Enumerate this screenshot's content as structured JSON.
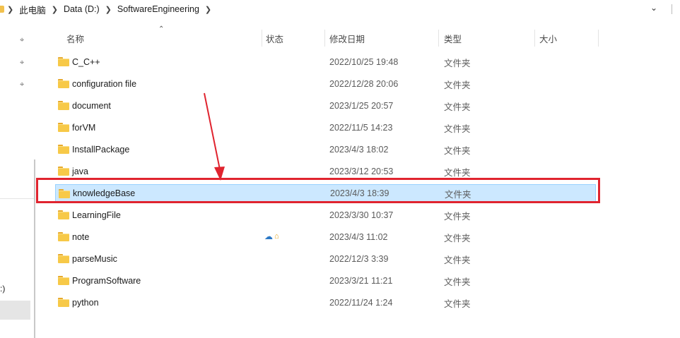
{
  "breadcrumb": {
    "items": [
      "此电脑",
      "Data (D:)",
      "SoftwareEngineering"
    ],
    "separator": ">"
  },
  "nav": {
    "partial_label": ":)"
  },
  "columns": {
    "name": "名称",
    "status": "状态",
    "date": "修改日期",
    "type": "类型",
    "size": "大小"
  },
  "files": [
    {
      "name": "C_C++",
      "date": "2022/10/25 19:48",
      "type": "文件夹"
    },
    {
      "name": "configuration file",
      "date": "2022/12/28 20:06",
      "type": "文件夹"
    },
    {
      "name": "document",
      "date": "2023/1/25 20:57",
      "type": "文件夹"
    },
    {
      "name": "forVM",
      "date": "2022/11/5 14:23",
      "type": "文件夹"
    },
    {
      "name": "InstallPackage",
      "date": "2023/4/3 18:02",
      "type": "文件夹"
    },
    {
      "name": "java",
      "date": "2023/3/12 20:53",
      "type": "文件夹"
    },
    {
      "name": "knowledgeBase",
      "date": "2023/4/3 18:39",
      "type": "文件夹",
      "selected": true
    },
    {
      "name": "LearningFile",
      "date": "2023/3/30 10:37",
      "type": "文件夹"
    },
    {
      "name": "note",
      "date": "2023/4/3 11:02",
      "type": "文件夹",
      "status_icons": [
        "cloud-icon",
        "lock-icon"
      ]
    },
    {
      "name": "parseMusic",
      "date": "2022/12/3 3:39",
      "type": "文件夹"
    },
    {
      "name": "ProgramSoftware",
      "date": "2023/3/21 11:21",
      "type": "文件夹"
    },
    {
      "name": "python",
      "date": "2022/11/24 1:24",
      "type": "文件夹"
    }
  ],
  "colors": {
    "selection_bg": "#cce8ff",
    "annotation_red": "#e0242f",
    "folder_yellow": "#f7c948"
  }
}
